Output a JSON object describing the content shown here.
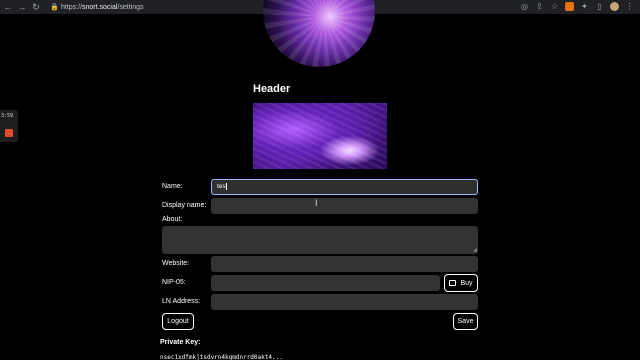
{
  "browser": {
    "url_scheme": "https://",
    "url_host": "snort.social",
    "url_path": "/settings",
    "back_icon": "←",
    "forward_icon": "→",
    "reload_icon": "↻"
  },
  "recorder": {
    "time": "3:59"
  },
  "profile": {
    "header_title": "Header",
    "fields": {
      "name_label": "Name:",
      "name_value": "tes",
      "display_name_label": "Display name:",
      "about_label": "About:",
      "website_label": "Website:",
      "nip05_label": "NIP-05:",
      "buy_label": "Buy",
      "ln_address_label": "LN Address:"
    },
    "logout_label": "Logout",
    "save_label": "Save",
    "private_key_label": "Private Key:",
    "private_key_value": "nsec1xdfmkjtsdvrn4kgmdnrrd0akt4..."
  }
}
